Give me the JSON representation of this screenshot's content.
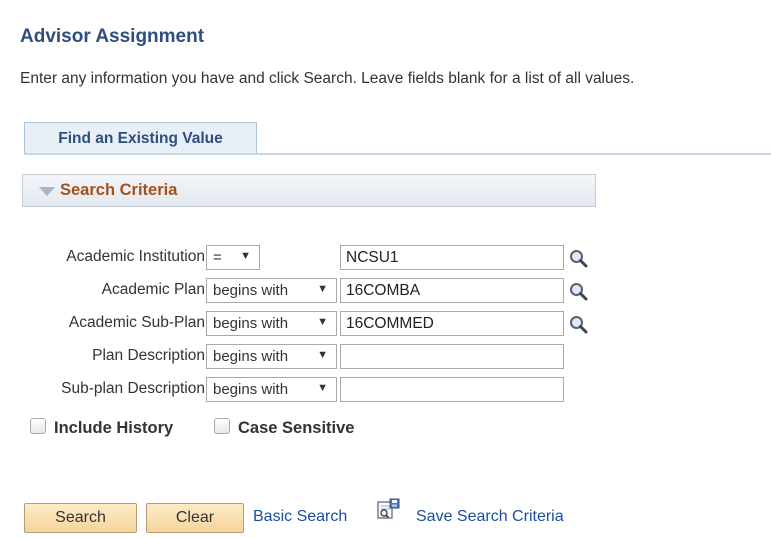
{
  "page": {
    "title": "Advisor Assignment",
    "instructions": "Enter any information you have and click Search. Leave fields blank for a list of all values."
  },
  "tabs": [
    {
      "label": "Find an Existing Value",
      "active": true
    }
  ],
  "search_criteria": {
    "header": "Search Criteria",
    "fields": [
      {
        "label": "Academic Institution",
        "operator": "=",
        "value": "NCSU1",
        "lookup": true
      },
      {
        "label": "Academic Plan",
        "operator": "begins with",
        "value": "16COMBA",
        "lookup": true
      },
      {
        "label": "Academic Sub-Plan",
        "operator": "begins with",
        "value": "16COMMED",
        "lookup": true
      },
      {
        "label": "Plan Description",
        "operator": "begins with",
        "value": "",
        "lookup": false
      },
      {
        "label": "Sub-plan Description",
        "operator": "begins with",
        "value": "",
        "lookup": false
      }
    ],
    "include_history": {
      "label": "Include History",
      "checked": false
    },
    "case_sensitive": {
      "label": "Case Sensitive",
      "checked": false
    }
  },
  "actions": {
    "search_label": "Search",
    "clear_label": "Clear",
    "basic_search_label": "Basic Search",
    "save_criteria_label": "Save Search Criteria"
  },
  "icons": {
    "lookup": "magnifier-icon",
    "save_criteria": "save-criteria-icon",
    "collapse": "triangle-down-icon",
    "dropdown": "chevron-down-icon"
  },
  "colors": {
    "title": "#2e4e80",
    "section_header_text": "#a4521a",
    "button_fill": "#f5d49c",
    "link": "#1a4fa0"
  }
}
